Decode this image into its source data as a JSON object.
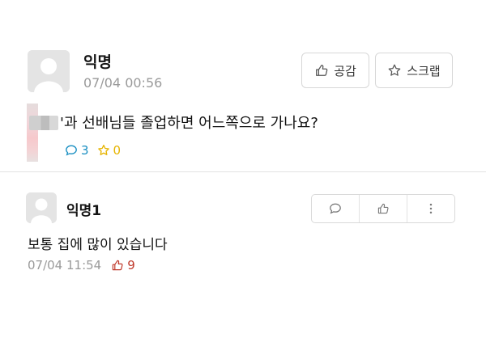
{
  "post": {
    "author": "익명",
    "time": "07/04 00:56",
    "like_button": "공감",
    "scrap_button": "스크랩",
    "title": "'과 선배님들 졸업하면 어느쪽으로 가나요?",
    "comment_count": "3",
    "scrap_count": "0"
  },
  "comment": {
    "author": "익명1",
    "text": "보통 집에 많이 있습니다",
    "time": "07/04 11:54",
    "like_count": "9"
  },
  "colors": {
    "comment_count": "#1a8fc2",
    "scrap_count": "#e6b400",
    "like_count": "#c0392b"
  }
}
